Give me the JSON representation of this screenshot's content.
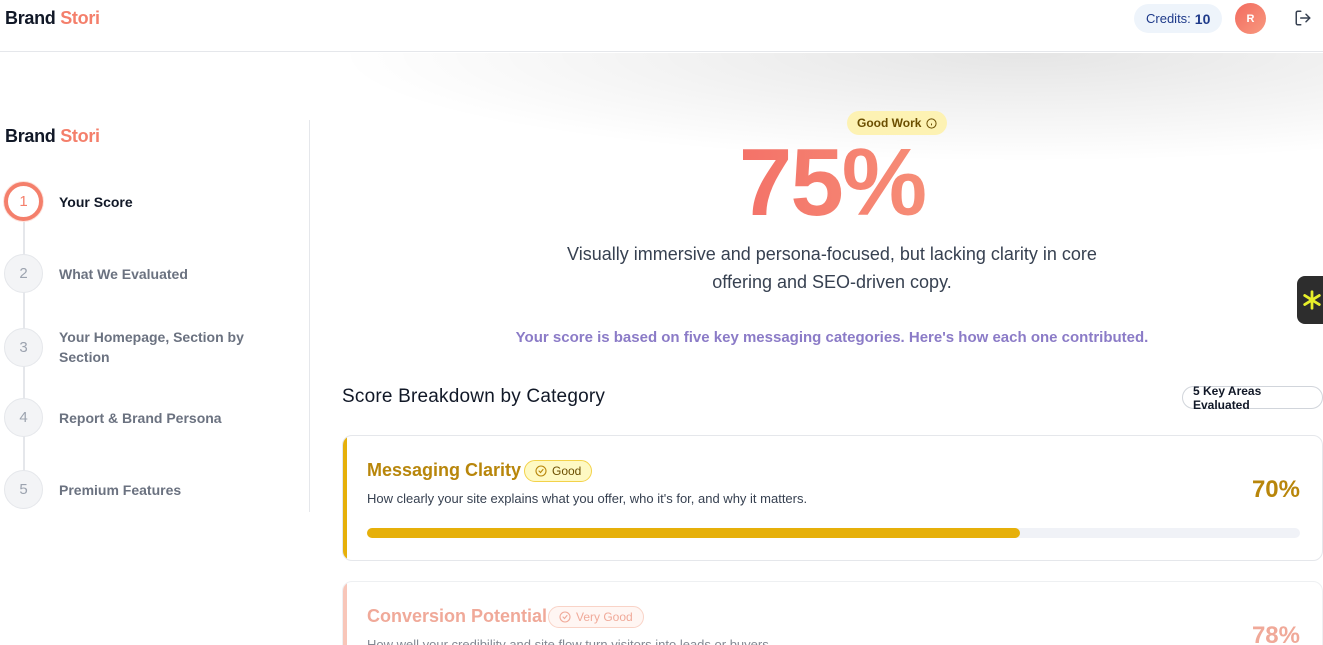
{
  "header": {
    "brand_part1": "Brand",
    "brand_part2": "Stori",
    "credits_label": "Credits:",
    "credits_value": "10",
    "avatar_initial": "R",
    "logout_icon": "logout-icon"
  },
  "sidebar": {
    "brand_part1": "Brand",
    "brand_part2": "Stori",
    "steps": [
      {
        "number": "1",
        "label": "Your Score",
        "active": true
      },
      {
        "number": "2",
        "label": "What We Evaluated",
        "active": false
      },
      {
        "number": "3",
        "label": "Your Homepage, Section by Section",
        "active": false
      },
      {
        "number": "4",
        "label": "Report & Brand Persona",
        "active": false
      },
      {
        "number": "5",
        "label": "Premium Features",
        "active": false
      }
    ]
  },
  "hero": {
    "badge": "Good Work",
    "score": "75%",
    "summary": "Visually immersive and persona-focused, but lacking clarity in core offering and SEO-driven copy.",
    "basis": "Your score is based on five key messaging categories. Here's how each one contributed."
  },
  "breakdown": {
    "title": "Score Breakdown by Category",
    "areas_badge": "5 Key Areas Evaluated",
    "categories": [
      {
        "name": "Messaging Clarity",
        "badge": "Good",
        "description": "How clearly your site explains what you offer, who it's for, and why it matters.",
        "score": "70%",
        "progress": 0.7
      },
      {
        "name": "Conversion Potential",
        "badge": "Very Good",
        "description": "How well your credibility and site flow turn visitors into leads or buyers.",
        "score": "78%",
        "progress": 0.78
      }
    ]
  },
  "colors": {
    "brand_accent": "#f47f6b",
    "good": "#e6b00a",
    "very_good": "#f4a48f",
    "basis_text": "#8b7bc7"
  }
}
